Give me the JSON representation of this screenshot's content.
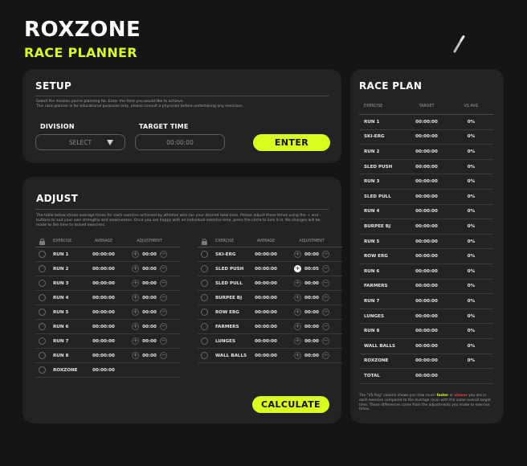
{
  "brand": {
    "title": "ROXZONE",
    "subtitle": "RACE PLANNER"
  },
  "colors": {
    "accent": "#d8ff1e",
    "slower": "#ff3b3b",
    "panel": "#222325",
    "background": "#151515"
  },
  "setup": {
    "title": "SETUP",
    "instructions_1": "Select the division you're planning for. Enter the time you would like to achieve.",
    "instructions_2": "This race planner is for educational purposes only, please consult a physician before undertaking any exercises.",
    "division_label": "DIVISION",
    "division_value": "SELECT",
    "target_label": "TARGET TIME",
    "target_placeholder": "00:00:00",
    "enter_label": "ENTER"
  },
  "adjust": {
    "title": "ADJUST",
    "instructions": "The table below shows average times for each exercise achieved by athletes who ran your desired total time. Please adjust these times using the + and - buttons to suit your own strengths and weaknesses. Once you are happy with an individual exercise time, press the circle to lock it in. No changes will be made to the time to locked exercises.",
    "headers": {
      "exercise": "EXERCISE",
      "average": "AVERAGE",
      "adjustment": "ADJUSTMENT"
    },
    "left_rows": [
      {
        "exercise": "RUN 1",
        "average": "00:00:00",
        "adjustment": "00:00"
      },
      {
        "exercise": "RUN 2",
        "average": "00:00:00",
        "adjustment": "00:00"
      },
      {
        "exercise": "RUN 3",
        "average": "00:00:00",
        "adjustment": "00:00"
      },
      {
        "exercise": "RUN 4",
        "average": "00:00:00",
        "adjustment": "00:00"
      },
      {
        "exercise": "RUN 5",
        "average": "00:00:00",
        "adjustment": "00:00"
      },
      {
        "exercise": "RUN 6",
        "average": "00:00:00",
        "adjustment": "00:00"
      },
      {
        "exercise": "RUN 7",
        "average": "00:00:00",
        "adjustment": "00:00"
      },
      {
        "exercise": "RUN 8",
        "average": "00:00:00",
        "adjustment": "00:00"
      },
      {
        "exercise": "ROXZONE",
        "average": "00:00:00",
        "adjustment": ""
      }
    ],
    "right_rows": [
      {
        "exercise": "SKI-ERG",
        "average": "00:00:00",
        "adjustment": "00:00"
      },
      {
        "exercise": "SLED PUSH",
        "average": "00:00:00",
        "adjustment": "00:05",
        "plus_active": true
      },
      {
        "exercise": "SLED PULL",
        "average": "00:00:00",
        "adjustment": "00:00"
      },
      {
        "exercise": "BURPEE BJ",
        "average": "00:00:00",
        "adjustment": "00:00"
      },
      {
        "exercise": "ROW ERG",
        "average": "00:00:00",
        "adjustment": "00:00"
      },
      {
        "exercise": "FARMERS",
        "average": "00:00:00",
        "adjustment": "00:00"
      },
      {
        "exercise": "LUNGES",
        "average": "00:00:00",
        "adjustment": "00:00"
      },
      {
        "exercise": "WALL BALLS",
        "average": "00:00:00",
        "adjustment": "00:00"
      }
    ],
    "calculate_label": "CALCULATE"
  },
  "plan": {
    "title": "RACE PLAN",
    "headers": {
      "exercise": "EXERCISE",
      "target": "TARGET",
      "vs_avg": "VS AVG"
    },
    "rows": [
      {
        "exercise": "RUN 1",
        "target": "00:00:00",
        "vs": "0%"
      },
      {
        "exercise": "SKI-ERG",
        "target": "00:00:00",
        "vs": "0%"
      },
      {
        "exercise": "RUN 2",
        "target": "00:00:00",
        "vs": "0%"
      },
      {
        "exercise": "SLED PUSH",
        "target": "00:00:00",
        "vs": "0%"
      },
      {
        "exercise": "RUN 3",
        "target": "00:00:00",
        "vs": "0%"
      },
      {
        "exercise": "SLED PULL",
        "target": "00:00:00",
        "vs": "0%"
      },
      {
        "exercise": "RUN 4",
        "target": "00:00:00",
        "vs": "0%"
      },
      {
        "exercise": "BURPEE BJ",
        "target": "00:00:00",
        "vs": "0%"
      },
      {
        "exercise": "RUN 5",
        "target": "00:00:00",
        "vs": "0%"
      },
      {
        "exercise": "ROW ERG",
        "target": "00:00:00",
        "vs": "0%"
      },
      {
        "exercise": "RUN 6",
        "target": "00:00:00",
        "vs": "0%"
      },
      {
        "exercise": "FARMERS",
        "target": "00:00:00",
        "vs": "0%"
      },
      {
        "exercise": "RUN 7",
        "target": "00:00:00",
        "vs": "0%"
      },
      {
        "exercise": "LUNGES",
        "target": "00:00:00",
        "vs": "0%"
      },
      {
        "exercise": "RUN 8",
        "target": "00:00:00",
        "vs": "0%"
      },
      {
        "exercise": "WALL BALLS",
        "target": "00:00:00",
        "vs": "0%"
      },
      {
        "exercise": "ROXZONE",
        "target": "00:00:00",
        "vs": "0%"
      },
      {
        "exercise": "TOTAL",
        "target": "00:00:00",
        "vs": ""
      }
    ],
    "note_before": "The \"VS Avg\" column shows you how much ",
    "note_faster": "faster",
    "note_or": " or ",
    "note_slower": "slower",
    "note_after": " you are in each exercise compared to the average racer with the same overall target time. These differences come from the adjustments you made to exercise times."
  }
}
